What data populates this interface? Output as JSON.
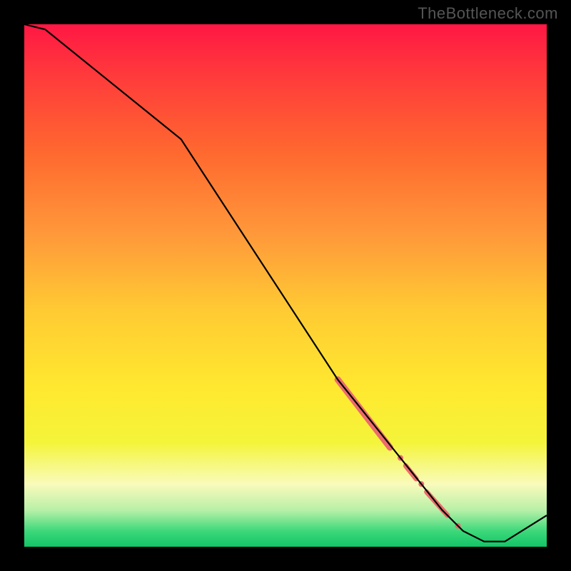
{
  "watermark": "TheBottleneck.com",
  "chart_data": {
    "type": "line",
    "title": "",
    "xlabel": "",
    "ylabel": "",
    "xlim": [
      0,
      100
    ],
    "ylim": [
      0,
      100
    ],
    "grid": false,
    "legend": false,
    "background_gradient": {
      "stops": [
        {
          "offset": 0.0,
          "color": "#ff1744"
        },
        {
          "offset": 0.1,
          "color": "#ff3b3b"
        },
        {
          "offset": 0.25,
          "color": "#ff6a2f"
        },
        {
          "offset": 0.4,
          "color": "#ff983a"
        },
        {
          "offset": 0.55,
          "color": "#ffcb33"
        },
        {
          "offset": 0.7,
          "color": "#ffe92f"
        },
        {
          "offset": 0.8,
          "color": "#f4f43a"
        },
        {
          "offset": 0.88,
          "color": "#f9fbbb"
        },
        {
          "offset": 0.93,
          "color": "#b8f0a8"
        },
        {
          "offset": 0.97,
          "color": "#3dd87a"
        },
        {
          "offset": 1.0,
          "color": "#12c566"
        }
      ]
    },
    "series": [
      {
        "name": "curve",
        "color": "#000000",
        "x": [
          0,
          4,
          30,
          60,
          68,
          72,
          76,
          80,
          84,
          88,
          92,
          100
        ],
        "values": [
          100,
          99,
          78,
          32,
          22,
          17,
          12,
          7,
          3,
          1,
          1,
          6
        ]
      }
    ],
    "line_markers": {
      "color": "#ec6b6b",
      "segments": [
        {
          "x1": 60,
          "y1": 32,
          "x2": 70,
          "y2": 19,
          "width": 9
        },
        {
          "x1": 73,
          "y1": 15.5,
          "x2": 75,
          "y2": 13,
          "width": 7
        },
        {
          "x1": 77,
          "y1": 10.5,
          "x2": 81,
          "y2": 6,
          "width": 7
        }
      ],
      "dots": [
        {
          "x": 72,
          "y": 17,
          "r": 4
        },
        {
          "x": 76,
          "y": 12,
          "r": 4
        },
        {
          "x": 83,
          "y": 4,
          "r": 4
        }
      ]
    }
  }
}
